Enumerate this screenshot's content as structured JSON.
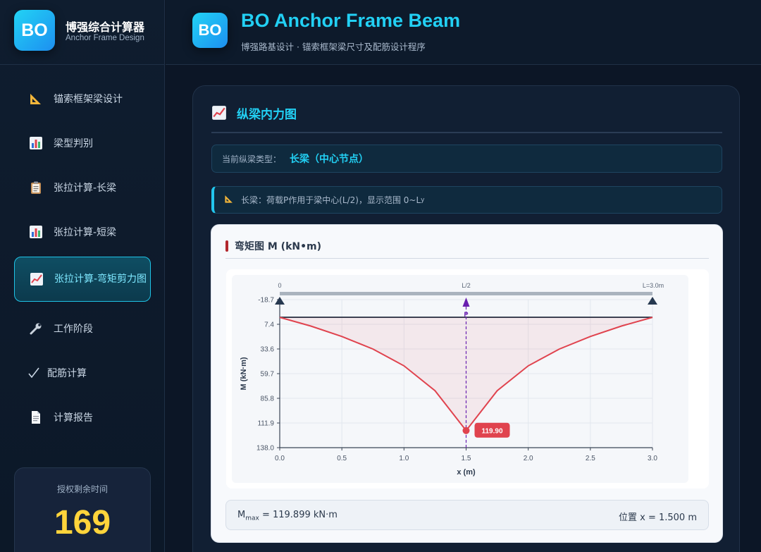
{
  "brand": {
    "logo": "BO",
    "title": "博强综合计算器",
    "subtitle": "Anchor Frame Design"
  },
  "header": {
    "logo": "BO",
    "title": "BO Anchor Frame Beam",
    "subtitle": "博强路基设计 · 锚索框架梁尺寸及配筋设计程序"
  },
  "sidebar": {
    "items": [
      {
        "label": "锚索框架梁设计",
        "icon": "triangle-ruler-icon"
      },
      {
        "label": "梁型判别",
        "icon": "bar-chart-icon"
      },
      {
        "label": "张拉计算-长梁",
        "icon": "clipboard-icon"
      },
      {
        "label": "张拉计算-短梁",
        "icon": "bar-chart-icon"
      },
      {
        "label": "张拉计算-弯矩剪力图",
        "icon": "trend-chart-icon",
        "active": true
      },
      {
        "label": "工作阶段",
        "icon": "wrench-icon"
      },
      {
        "label": "配筋计算",
        "icon": "check-icon"
      },
      {
        "label": "计算报告",
        "icon": "document-icon"
      }
    ]
  },
  "license": {
    "title": "授权剩余时间",
    "value": "169"
  },
  "main": {
    "section_title": "纵梁内力图",
    "section_icon": "trend-chart-icon",
    "beam_type": {
      "label": "当前纵梁类型：",
      "value": "长梁（中心节点）"
    },
    "note": {
      "icon": "triangle-ruler-icon",
      "text": "长梁：荷载P作用于梁中心(L/2)，显示范围 0~L",
      "sub": "y"
    },
    "diagram_title": "弯矩图 M (kN•m)",
    "result": {
      "m_symbol": "M",
      "m_sub": "max",
      "m_text": " = 119.899 kN·m",
      "position": "位置 x = 1.500 m"
    }
  },
  "colors": {
    "accent": "#22d0f4",
    "license": "#ffd43b",
    "curve": "#e0434e",
    "load": "#6a1fb0",
    "support": "#26384f"
  },
  "chart_data": {
    "type": "line",
    "title": "弯矩图 M (kN•m)",
    "xlabel": "x (m)",
    "ylabel": "M (kN·m)",
    "xlim": [
      0,
      3
    ],
    "ylim": [
      -18.7,
      138.0
    ],
    "y_inverted": true,
    "x_ticks": [
      "0.0",
      "0.5",
      "1.0",
      "1.5",
      "2.0",
      "2.5",
      "3.0"
    ],
    "y_ticks": [
      "-18.7",
      "7.4",
      "33.6",
      "59.7",
      "85.8",
      "111.9",
      "138.0"
    ],
    "top_labels": [
      "0",
      "L/2",
      "L=3.0m"
    ],
    "load_label": "P",
    "series": [
      {
        "x": [
          0,
          0.25,
          0.5,
          0.75,
          1.0,
          1.25,
          1.5,
          1.75,
          2.0,
          2.25,
          2.5,
          2.75,
          3.0
        ],
        "y": [
          0,
          9.3,
          20.3,
          33.6,
          51.4,
          77.7,
          119.9,
          77.7,
          51.4,
          33.6,
          20.3,
          9.3,
          0
        ]
      }
    ],
    "peak": {
      "x": 1.5,
      "y": 119.9,
      "label": "119.90"
    }
  }
}
